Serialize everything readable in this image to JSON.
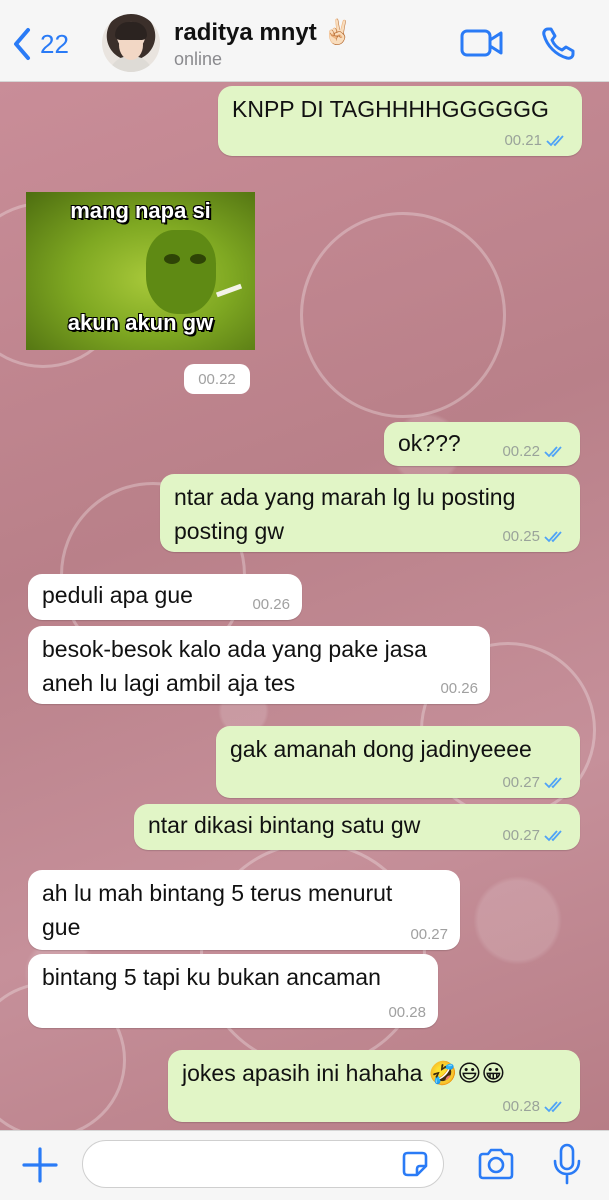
{
  "header": {
    "back_count": "22",
    "contact_name": "raditya mnyt",
    "contact_emoji": "✌🏻",
    "status": "online",
    "accent_color": "#2a7bf6"
  },
  "messages": [
    {
      "direction": "out",
      "text": "KNPP DI TAGHHHHGGGGGG",
      "time": "00.21",
      "read": true
    },
    {
      "direction": "in",
      "type": "sticker",
      "caption_top": "mang napa si",
      "caption_bottom": "akun akun gw",
      "time": "00.22"
    },
    {
      "direction": "out",
      "text": "ok???",
      "time": "00.22",
      "read": true
    },
    {
      "direction": "out",
      "text_lines": [
        "ntar ada yang marah lg lu posting",
        "posting gw"
      ],
      "time": "00.25",
      "read": true
    },
    {
      "direction": "in",
      "text": "peduli apa gue",
      "time": "00.26"
    },
    {
      "direction": "in",
      "text_lines": [
        "besok-besok kalo ada yang pake jasa",
        "aneh lu lagi ambil aja tes"
      ],
      "time": "00.26"
    },
    {
      "direction": "out",
      "text": "gak amanah dong jadinyeeee",
      "time": "00.27",
      "read": true
    },
    {
      "direction": "out",
      "text": "ntar dikasi bintang satu gw",
      "time": "00.27",
      "read": true
    },
    {
      "direction": "in",
      "text_lines": [
        "ah lu mah bintang 5 terus menurut",
        "gue"
      ],
      "time": "00.27"
    },
    {
      "direction": "in",
      "text": "bintang 5 tapi ku bukan ancaman",
      "time": "00.28"
    },
    {
      "direction": "out",
      "text": "jokes apasih ini hahaha 🤣😃😀",
      "time": "00.28",
      "read": true
    }
  ],
  "input": {
    "placeholder": ""
  },
  "colors": {
    "outgoing_bubble": "#e1f5c6",
    "incoming_bubble": "#ffffff",
    "read_tick": "#4fa3f7"
  }
}
